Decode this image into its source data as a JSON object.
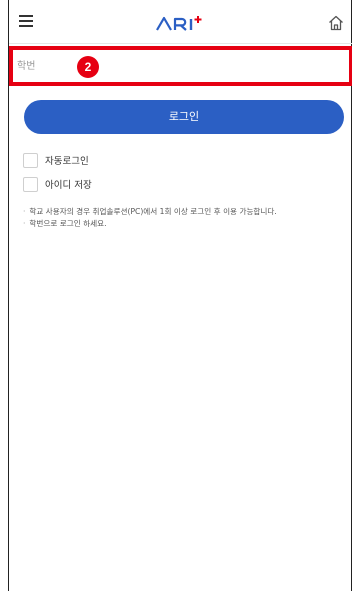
{
  "header": {
    "logo_text": "ARI+",
    "menu_icon": "hamburger-menu-icon",
    "home_icon": "home-icon",
    "brand_color": "#2b5fc4",
    "accent_color": "#e60012"
  },
  "login_form": {
    "student_id_placeholder": "학번",
    "student_id_value": "",
    "step_badge": "2",
    "login_button_label": "로그인",
    "auto_login_label": "자동로그인",
    "save_id_label": "아이디 저장"
  },
  "notes": [
    "학교 사용자의 경우 취업솔루션(PC)에서 1회 이상 로그인 후 이용 가능합니다.",
    "학번으로 로그인 하세요."
  ]
}
